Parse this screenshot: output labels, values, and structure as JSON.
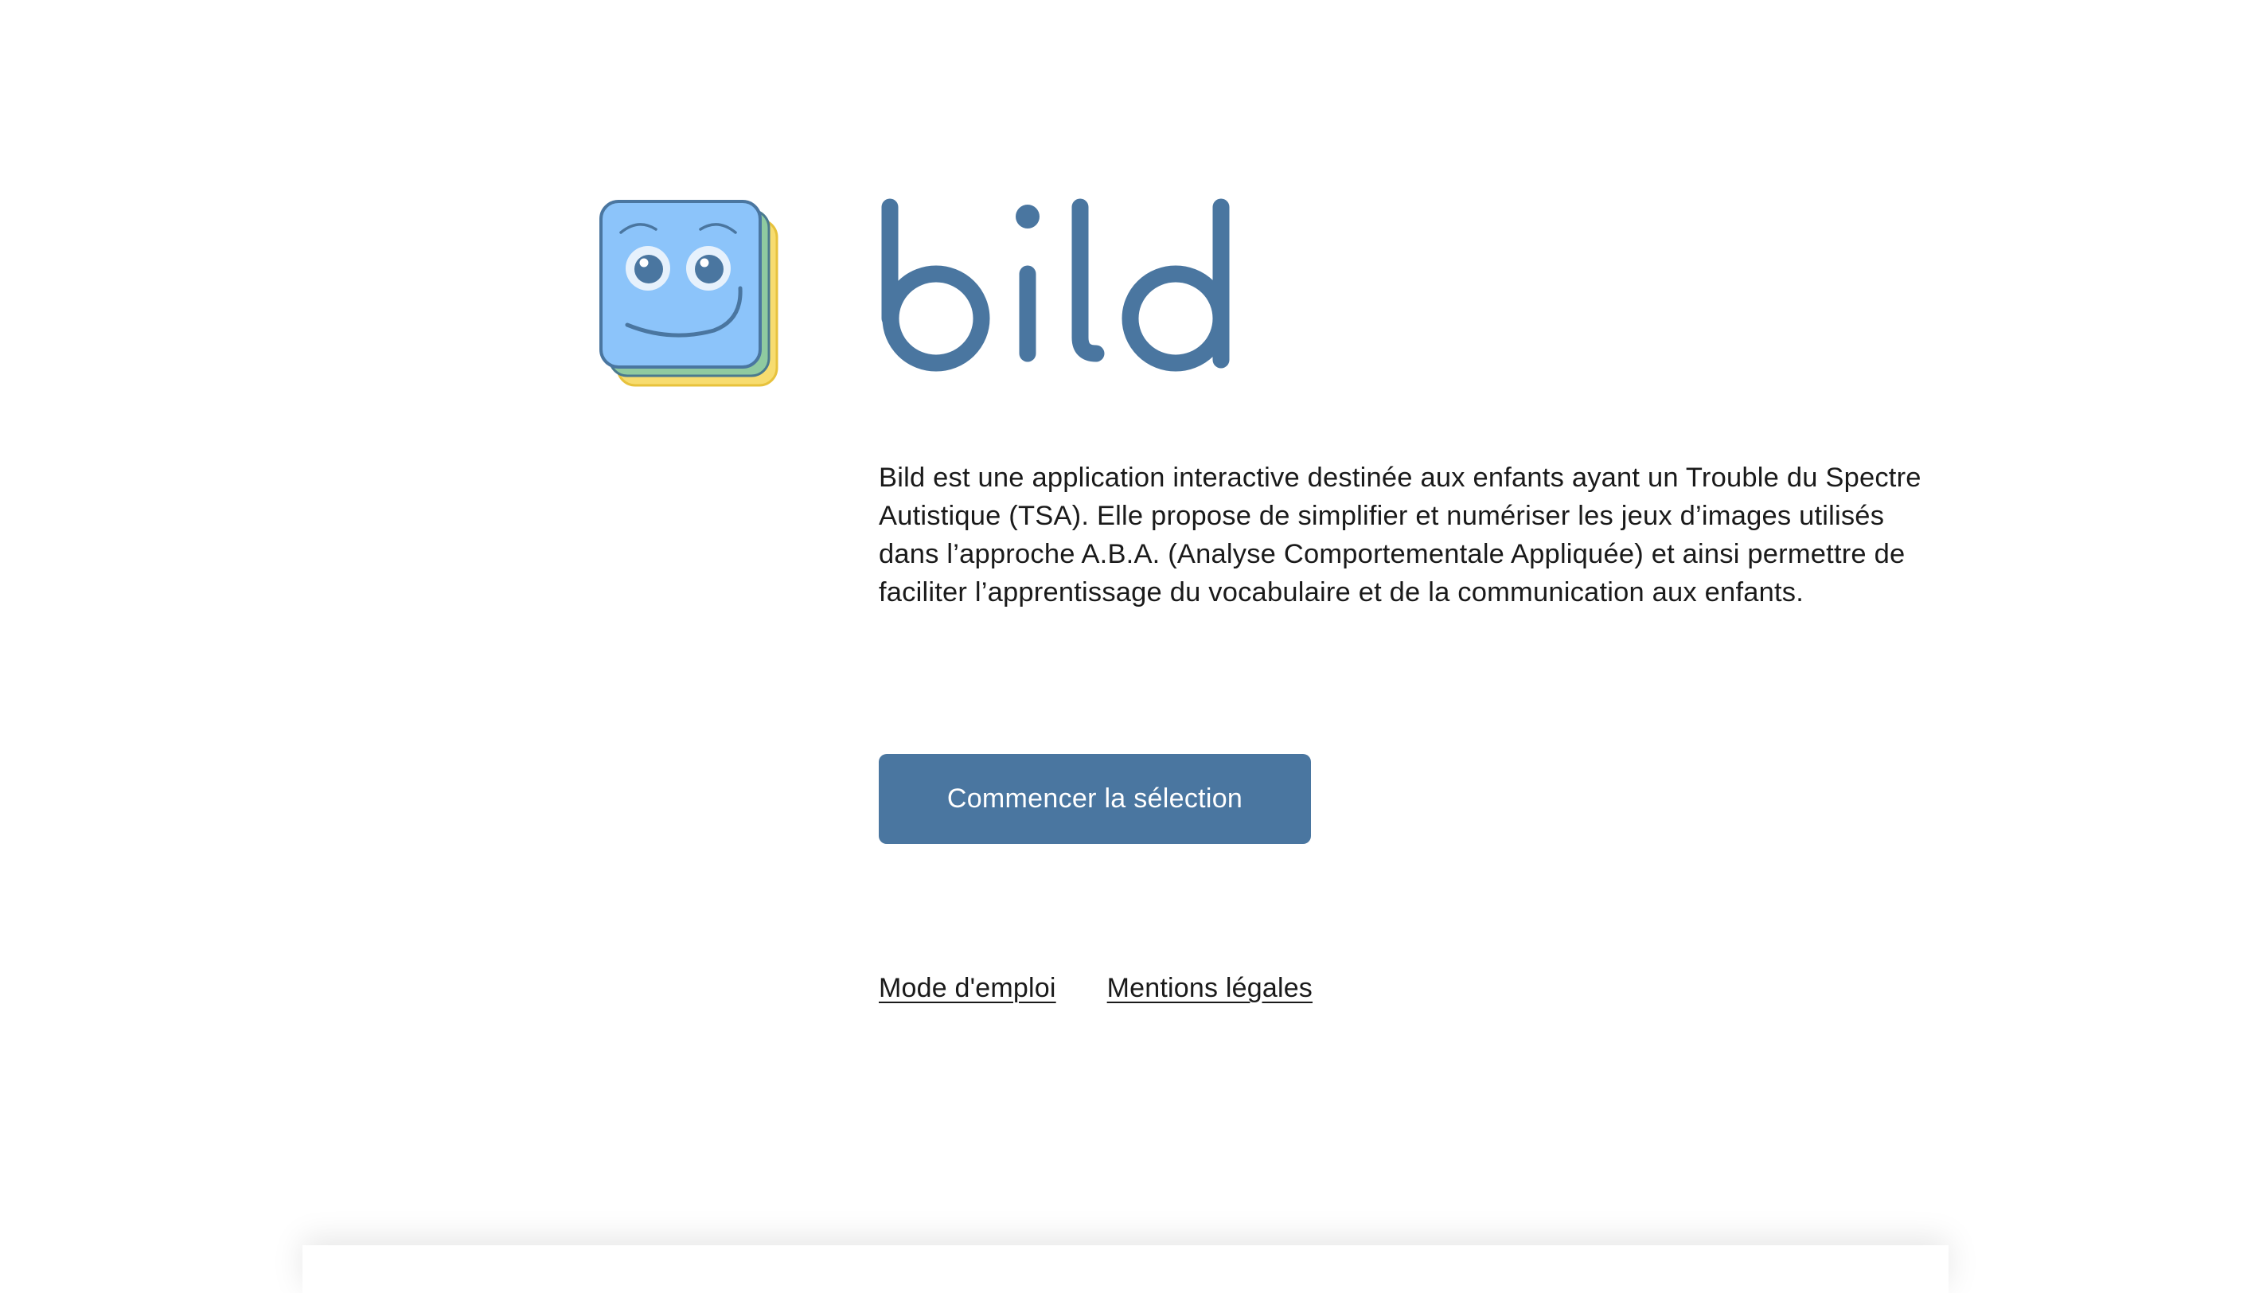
{
  "app": {
    "name": "bild"
  },
  "intro": {
    "description": "Bild est une application interactive destinée aux enfants ayant un Trouble du Spectre Autistique (TSA). Elle propose de simplifier et numériser les jeux d’images utilisés dans l’approche A.B.A. (Analyse Comportementale Appliquée) et ainsi permettre de faciliter l’apprentissage du vocabulaire et de la communication aux enfants."
  },
  "actions": {
    "start_label": "Commencer la sélection"
  },
  "footer": {
    "links": [
      {
        "label": "Mode d'emploi"
      },
      {
        "label": "Mentions légales"
      }
    ]
  },
  "icons": {
    "logo": "smiling-card-stack-icon"
  },
  "colors": {
    "brand": "#4a76a0",
    "logo_card_blue": "#8cc4fa",
    "logo_card_green": "#8fcaa0",
    "logo_card_yellow": "#f7dc6f",
    "text": "#1a1a1a",
    "background": "#ffffff"
  }
}
